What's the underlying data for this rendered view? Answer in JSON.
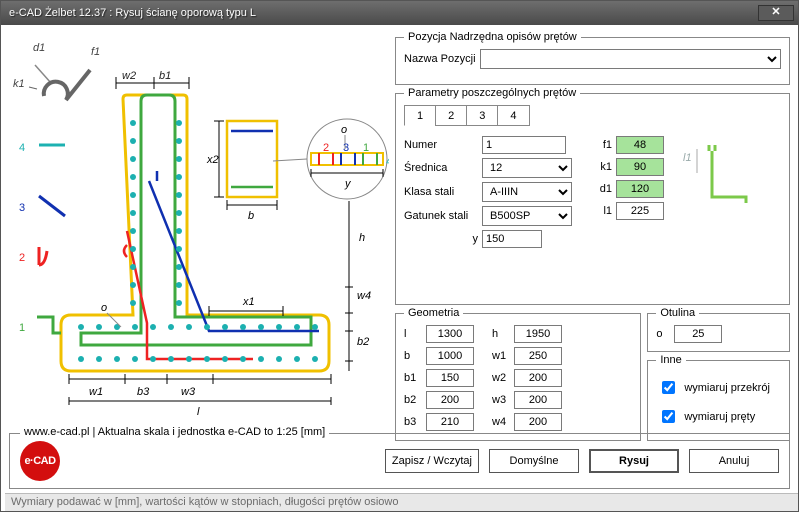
{
  "window": {
    "title": "e-CAD Żelbet 12.37 : Rysuj ścianę oporową typu L"
  },
  "groups": {
    "pozycja": "Pozycja Nadrzędna opisów prętów",
    "parametry": "Parametry poszczególnych prętów",
    "geometria": "Geometria",
    "otulina": "Otulina",
    "inne": "Inne"
  },
  "tabs": [
    "1",
    "2",
    "3",
    "4"
  ],
  "labels": {
    "nazwa_pozycji": "Nazwa Pozycji",
    "numer": "Numer",
    "srednica": "Średnica",
    "klasa": "Klasa stali",
    "gatunek": "Gatunek stali",
    "y": "y",
    "f1": "f1",
    "k1": "k1",
    "d1": "d1",
    "l1": "l1",
    "l": "l",
    "b": "b",
    "b1": "b1",
    "b2": "b2",
    "b3": "b3",
    "h": "h",
    "w1": "w1",
    "w2": "w2",
    "w3": "w3",
    "w4": "w4",
    "o": "o",
    "wymiaruj_przekroj": "wymiaruj przekrój",
    "wymiaruj_prety": "wymiaruj pręty"
  },
  "params": {
    "numer": "1",
    "srednica": "12",
    "klasa": "A-IIIN",
    "gatunek": "B500SP",
    "y": "150",
    "f1": "48",
    "k1": "90",
    "d1": "120",
    "l1": "225"
  },
  "geo": {
    "l": "1300",
    "b": "1000",
    "b1": "150",
    "b2": "200",
    "b3": "210",
    "h": "1950",
    "w1": "250",
    "w2": "200",
    "w3": "200",
    "w4": "200"
  },
  "cover": {
    "o": "25"
  },
  "inne": {
    "wymiaruj_przekroj": true,
    "wymiaruj_prety": true
  },
  "buttons": {
    "zapisz": "Zapisz / Wczytaj",
    "domyslne": "Domyślne",
    "rysuj": "Rysuj",
    "anuluj": "Anuluj"
  },
  "footer": {
    "legend": "www.e-cad.pl | Aktualna skala i jednostka e-CAD to 1:25 [mm]",
    "logo": "e·CAD",
    "status": "Wymiary podawać w [mm], wartości kątów w stopniach, długości prętów osiowo"
  }
}
